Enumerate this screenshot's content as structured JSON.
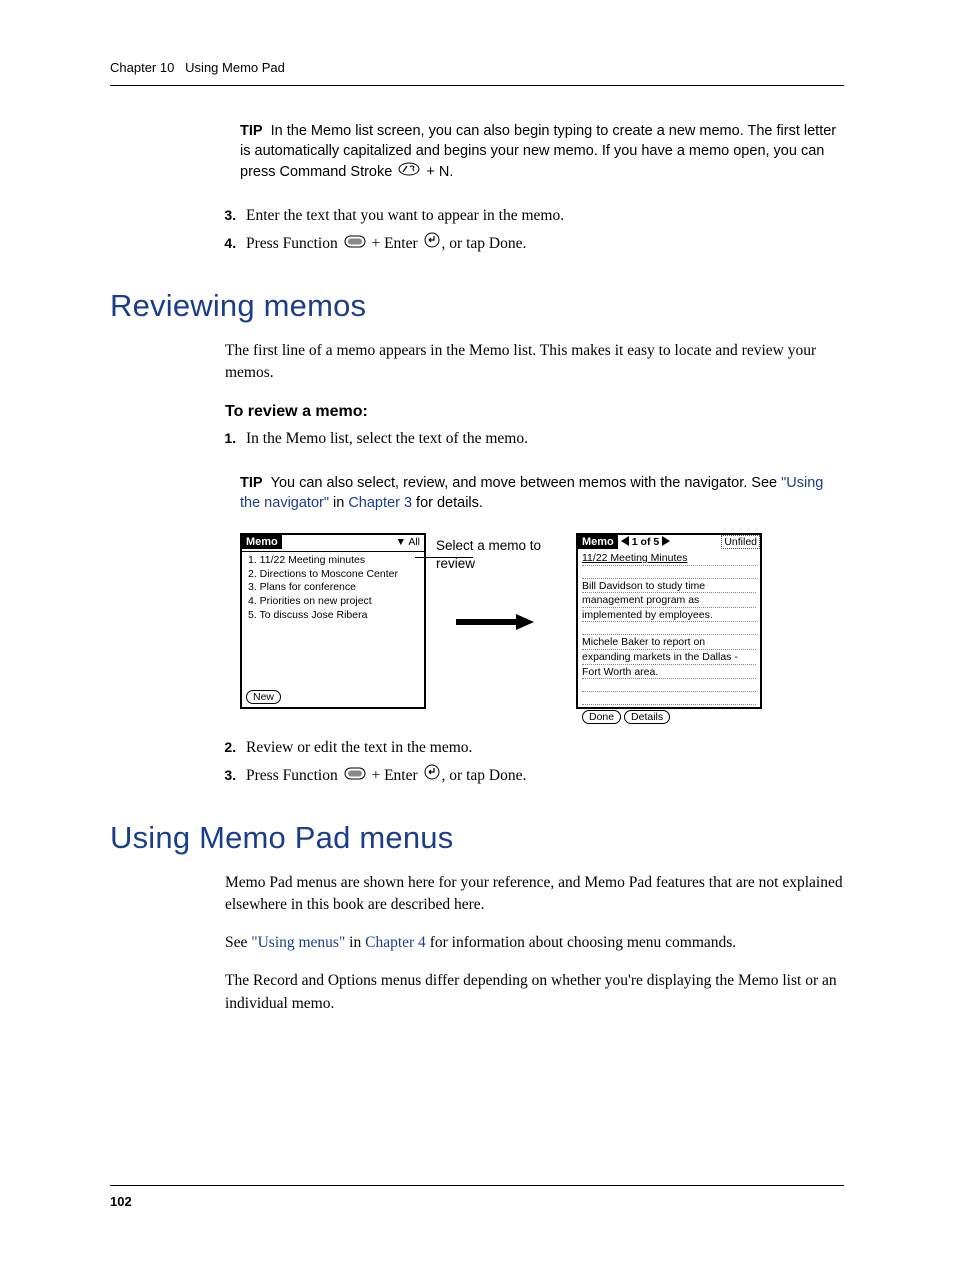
{
  "header": {
    "chapter": "Chapter 10",
    "title": "Using Memo Pad"
  },
  "tip1": {
    "label": "TIP",
    "text_before": "In the Memo list screen, you can also begin typing to create a new memo. The first letter is automatically capitalized and begins your new memo. If you have a memo open, you can press Command Stroke ",
    "text_after": " + N."
  },
  "steps_a": {
    "s3": "Enter the text that you want to appear in the memo.",
    "s4_a": "Press Function ",
    "s4_b": " + Enter ",
    "s4_c": ", or tap Done."
  },
  "section1": {
    "heading": "Reviewing memos",
    "para": "The first line of a memo appears in the Memo list. This makes it easy to locate and review your memos.",
    "subhead": "To review a memo:",
    "step1": "In the Memo list, select the text of the memo."
  },
  "tip2": {
    "label": "TIP",
    "text_a": "You can also select, review, and move between memos with the navigator. See ",
    "link1": "\"Using the navigator\"",
    "text_b": " in ",
    "link2": "Chapter 3",
    "text_c": " for details."
  },
  "figure": {
    "left": {
      "title": "Memo",
      "category": "▼ All",
      "items": [
        "1.  11/22 Meeting minutes",
        "2.  Directions to Moscone Center",
        "3.  Plans for conference",
        "4.  Priorities on new project",
        "5.  To discuss Jose Ribera"
      ],
      "btn_new": "New"
    },
    "mid": {
      "label": "Select a memo to review"
    },
    "right": {
      "title": "Memo",
      "counter": "1 of 5",
      "category": "Unfiled",
      "line_title": "11/22 Meeting Minutes",
      "line_p1a": "Bill Davidson to study time",
      "line_p1b": "management program as",
      "line_p1c": "implemented by employees.",
      "line_p2a": "Michele Baker to report on",
      "line_p2b": "expanding markets in the Dallas -",
      "line_p2c": "Fort Worth area.",
      "btn_done": "Done",
      "btn_details": "Details"
    }
  },
  "steps_b": {
    "s2": "Review or edit the text in the memo.",
    "s3_a": "Press Function ",
    "s3_b": " + Enter ",
    "s3_c": ", or tap Done."
  },
  "section2": {
    "heading": "Using Memo Pad menus",
    "para1": "Memo Pad menus are shown here for your reference, and Memo Pad features that are not explained elsewhere in this book are described here.",
    "para2_a": "See ",
    "para2_link1": "\"Using menus\"",
    "para2_b": " in ",
    "para2_link2": "Chapter 4",
    "para2_c": " for information about choosing menu commands.",
    "para3": "The Record and Options menus differ depending on whether you're displaying the Memo list or an individual memo."
  },
  "footer": {
    "page": "102"
  }
}
